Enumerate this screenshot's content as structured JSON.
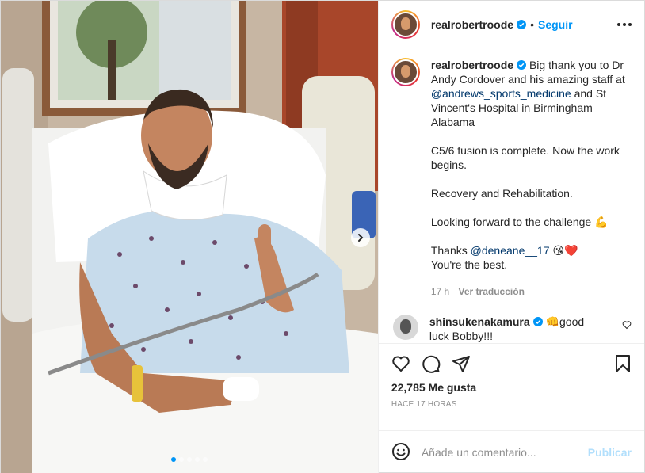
{
  "post": {
    "username": "realrobertroode",
    "separator": "•",
    "follow_label": "Seguir",
    "image_alt": "Hospital bed photo"
  },
  "caption": {
    "username": "realrobertroode",
    "line1": "Big thank you to Dr Andy Cordover and his amazing staff at ",
    "mention1": "@andrews_sports_medicine",
    "line1b": " and St Vincent's Hospital in Birmingham Alabama",
    "para2": "C5/6 fusion is complete. Now the work begins.",
    "para3": "Recovery and Rehabilitation.",
    "para4": "Looking forward to the challenge 💪",
    "para5_prefix": "Thanks ",
    "mention2": "@deneane__17",
    "para5_suffix": " 😘❤️",
    "para5_line2": "You're the best.",
    "time": "17 h",
    "translate": "Ver traducción"
  },
  "comment": {
    "username": "shinsukenakamura",
    "text": " 👊good luck Bobby!!!"
  },
  "footer": {
    "likes": "22,785 Me gusta",
    "time_ago": "HACE 17 HORAS",
    "comment_placeholder": "Añade un comentario...",
    "publish_label": "Publicar"
  },
  "carousel": {
    "dots": 5,
    "active_index": 0
  },
  "colors": {
    "accent": "#0095f6",
    "verified": "#0095f6",
    "mention": "#00376b",
    "muted": "#8e8e8e"
  },
  "icons": [
    "heart-icon",
    "comment-icon",
    "share-icon",
    "bookmark-icon",
    "emoji-icon",
    "more-icon",
    "chevron-right-icon",
    "verified-icon"
  ]
}
